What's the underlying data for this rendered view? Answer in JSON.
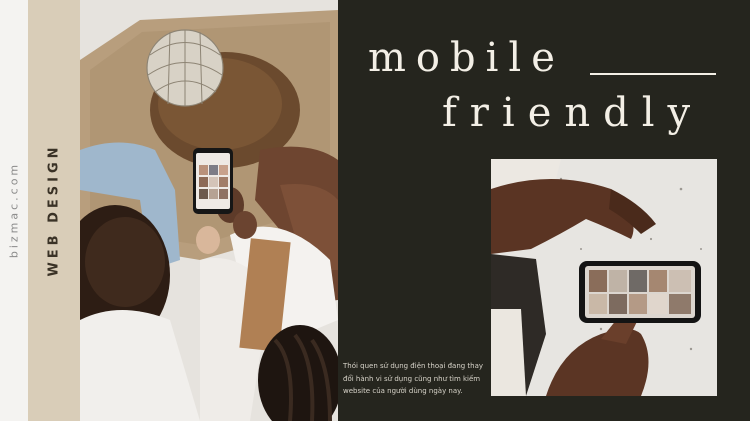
{
  "side": {
    "url_text": "bizmac.com",
    "category_text": "WEB DESIGN"
  },
  "title": {
    "line1": "mobile",
    "line2": "friendly"
  },
  "caption": "Thói quen sử dụng điện thoại đang thay đổi hành vi sử dụng cũng như tìm kiếm website của người dùng ngày nay.",
  "colors": {
    "dark_panel": "#25251e",
    "tan_strip": "#d9cdb8",
    "title_text": "#f3efe6"
  }
}
